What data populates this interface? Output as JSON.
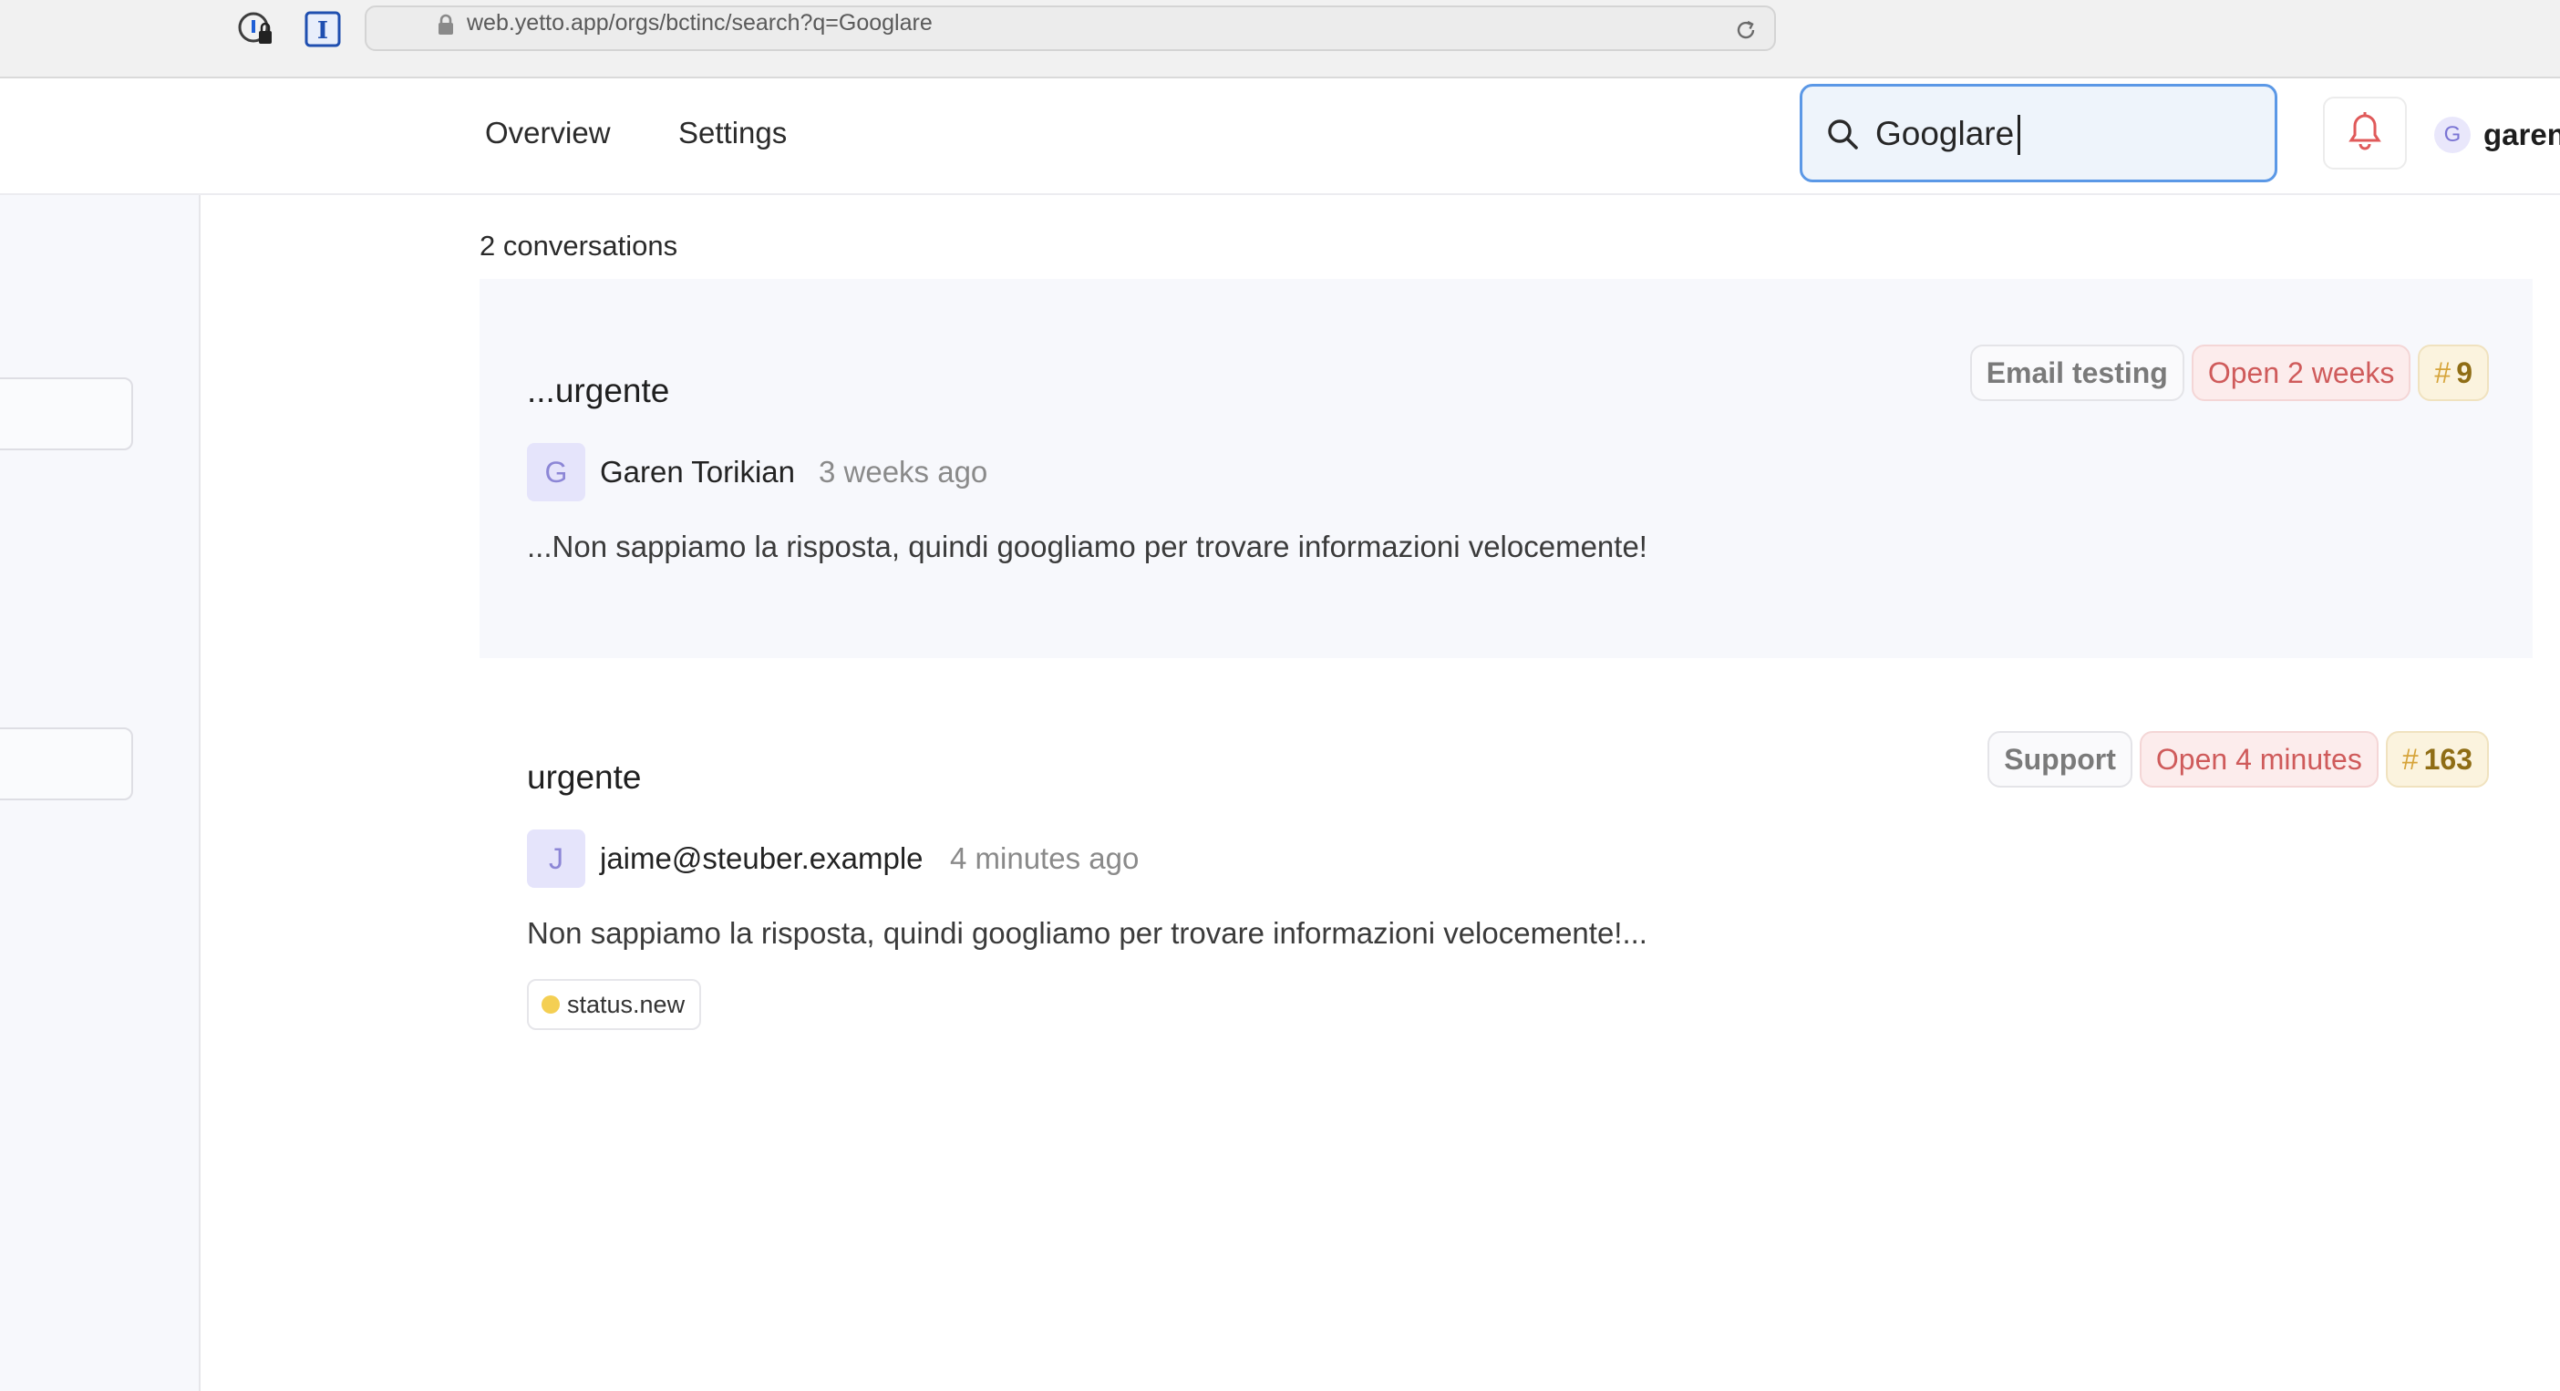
{
  "browser": {
    "url_text": "web.yetto.app/orgs/bctinc/search?q=Googlare",
    "extension_icons": [
      "password-manager-icon",
      "instapaper-icon"
    ]
  },
  "nav": {
    "items": [
      {
        "label": "Overview"
      },
      {
        "label": "Settings"
      }
    ]
  },
  "search": {
    "value": "Googlare"
  },
  "user": {
    "avatar_initial": "G",
    "name": "garen"
  },
  "results": {
    "count_label": "2 conversations",
    "conversations": [
      {
        "title": "...urgente",
        "inbox": "Email testing",
        "status": "Open 2 weeks",
        "number_hash": "#",
        "number": "9",
        "author_initial": "G",
        "author": "Garen Torikian",
        "time_ago": "3 weeks ago",
        "snippet": "...Non sappiamo la risposta, quindi googliamo per trovare informazioni velocemente!",
        "tags": []
      },
      {
        "title": "urgente",
        "inbox": "Support",
        "status": "Open 4 minutes",
        "number_hash": "#",
        "number": "163",
        "author_initial": "J",
        "author": "jaime@steuber.example",
        "time_ago": "4 minutes ago",
        "snippet": "Non sappiamo la risposta, quindi googliamo per trovare informazioni velocemente!...",
        "tags": [
          {
            "label": "status.new",
            "color": "#f4cf53"
          }
        ]
      }
    ]
  },
  "colors": {
    "accent_focus": "#5b98e6",
    "open_status": "#cf5b5b",
    "number_badge": "#8f6d15",
    "card_highlight": "#f7f8fc"
  }
}
